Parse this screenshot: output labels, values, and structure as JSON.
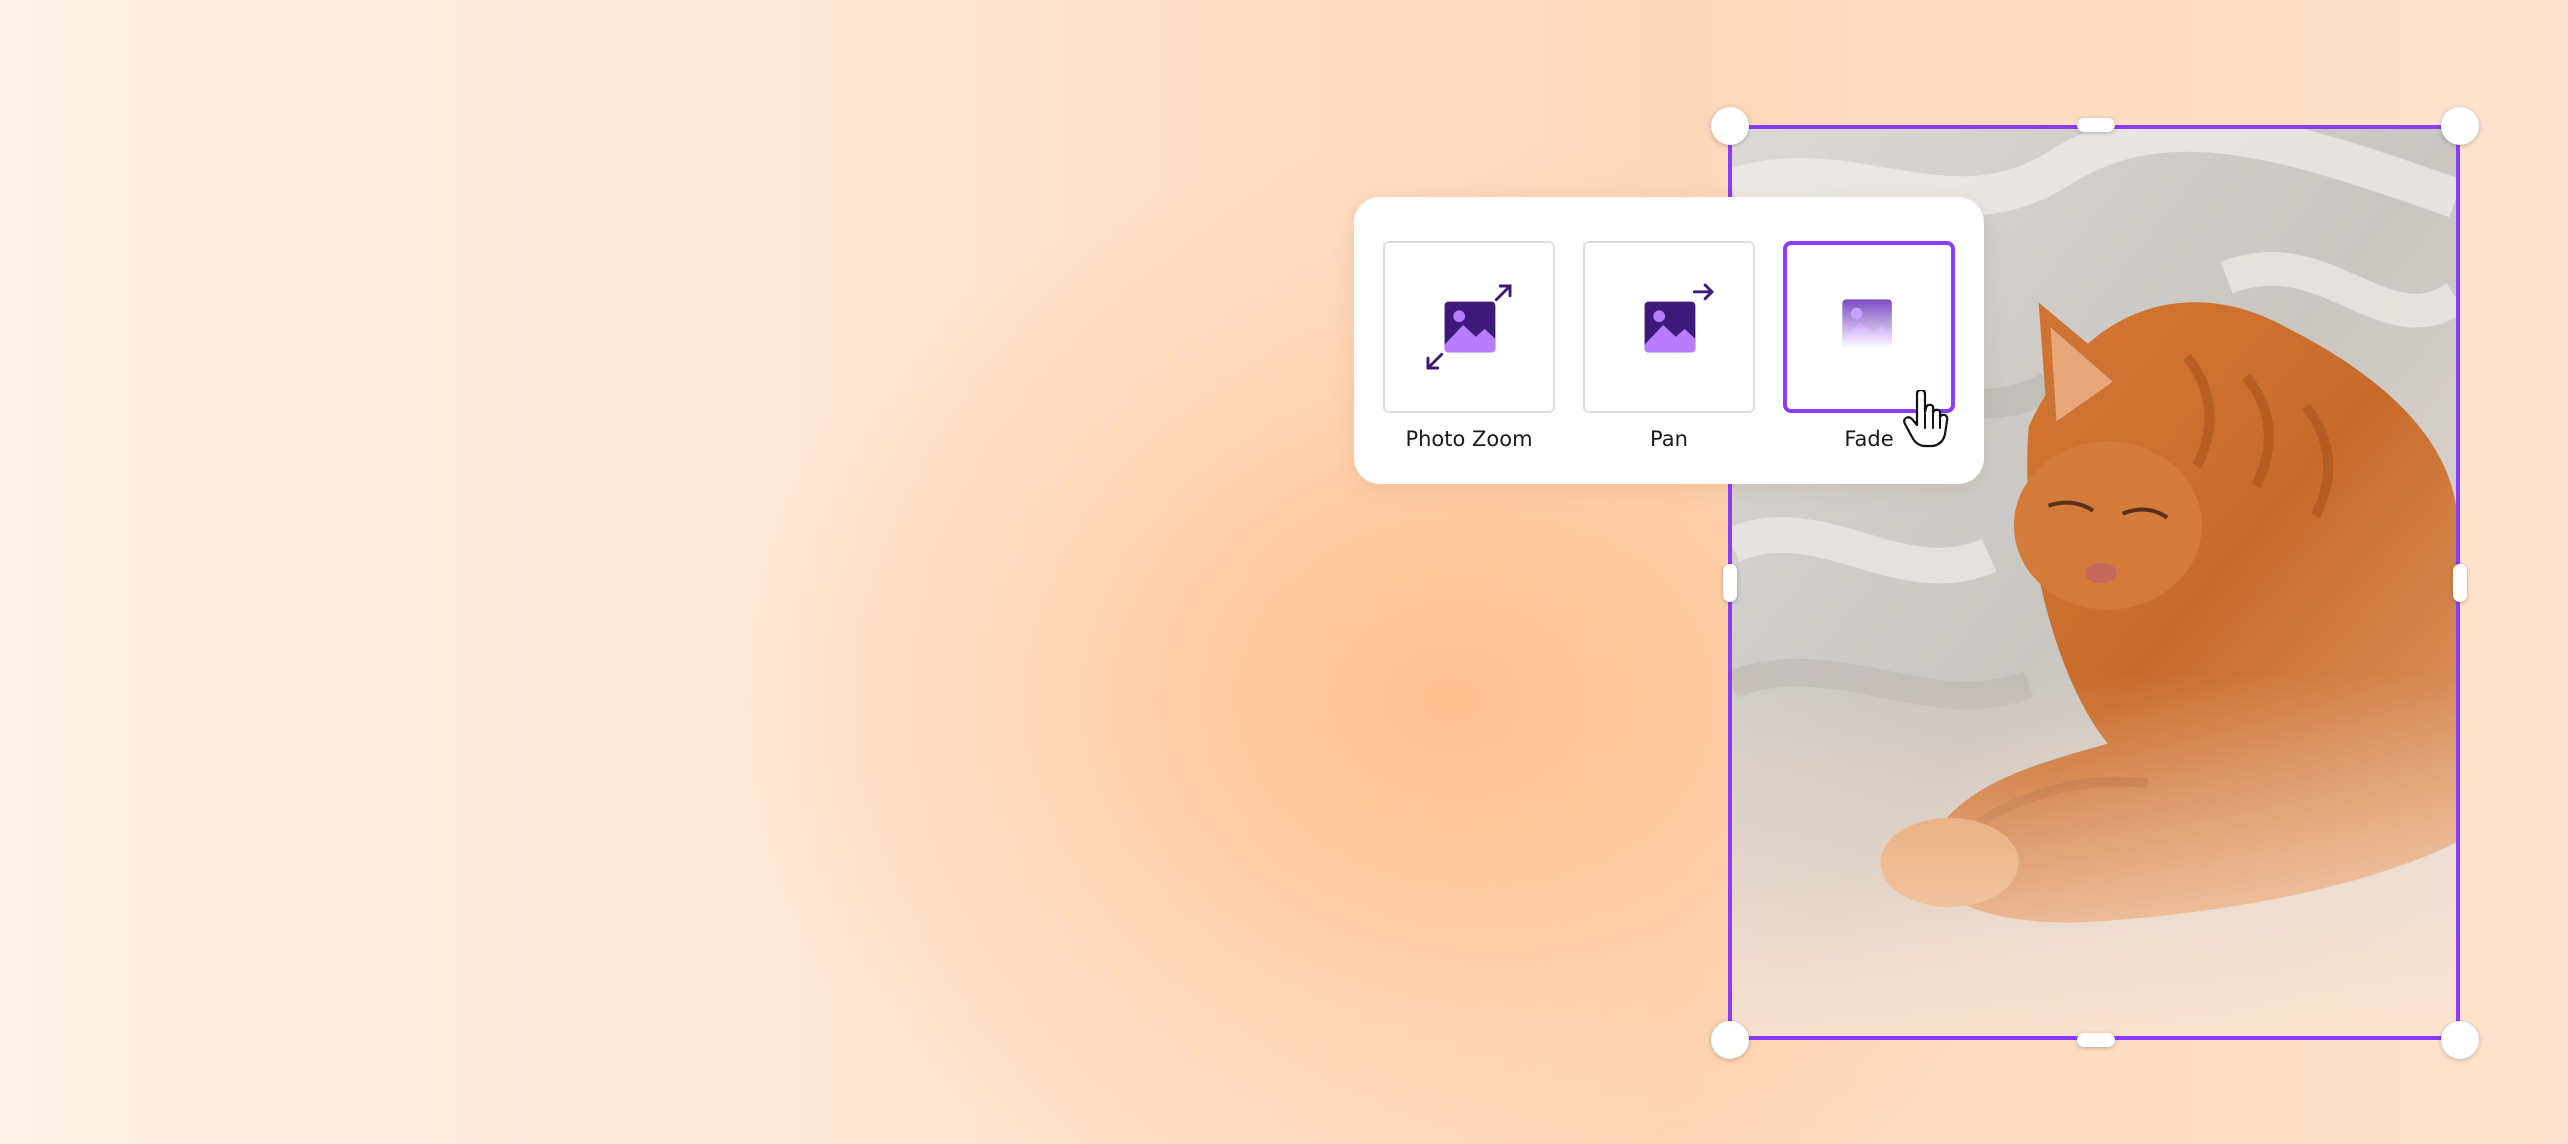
{
  "animation_picker": {
    "options": [
      {
        "label": "Photo Zoom",
        "icon": "image-zoom-icon",
        "selected": false
      },
      {
        "label": "Pan",
        "icon": "image-pan-icon",
        "selected": false
      },
      {
        "label": "Fade",
        "icon": "image-fade-icon",
        "selected": true
      }
    ]
  },
  "photo": {
    "subject": "ginger cat sleeping on gray bedding",
    "selected": true
  },
  "colors": {
    "accent": "#8b3dff",
    "icon_dark": "#3d1a78",
    "icon_light": "#b77cff",
    "background": "#fde3cf"
  }
}
